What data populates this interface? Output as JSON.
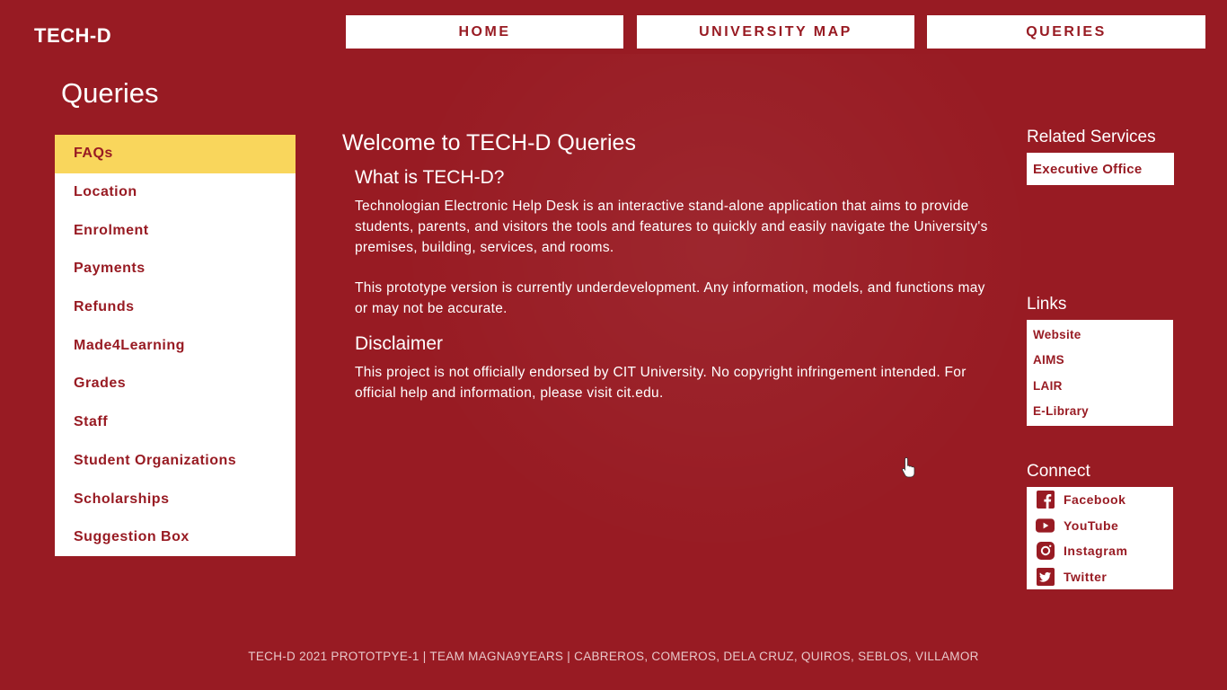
{
  "app": {
    "logo": "TECH-D"
  },
  "nav": {
    "home": "HOME",
    "map": "UNIVERSITY MAP",
    "queries": "QUERIES"
  },
  "page": {
    "title": "Queries"
  },
  "sidebar": {
    "items": [
      {
        "label": "FAQs",
        "active": true
      },
      {
        "label": "Location"
      },
      {
        "label": "Enrolment"
      },
      {
        "label": "Payments"
      },
      {
        "label": "Refunds"
      },
      {
        "label": "Made4Learning"
      },
      {
        "label": "Grades"
      },
      {
        "label": "Staff"
      },
      {
        "label": "Student Organizations"
      },
      {
        "label": "Scholarships"
      },
      {
        "label": "Suggestion Box"
      }
    ]
  },
  "main": {
    "title": "Welcome to TECH-D Queries",
    "what": {
      "heading": "What is TECH-D?",
      "p1": "Technologian Electronic Help Desk  is an interactive stand-alone application that aims to provide students, parents, and visitors the tools and features to quickly and easily navigate the University's premises, building, services, and rooms.",
      "p2": "This prototype version is currently underdevelopment. Any information, models, and functions may or may not be accurate."
    },
    "disclaimer": {
      "heading": "Disclaimer",
      "p": "This project is not officially endorsed by CIT University. No copyright infringement intended. For official help and information, please visit cit.edu."
    }
  },
  "related": {
    "heading": "Related Services",
    "items": [
      "Executive Office"
    ]
  },
  "links": {
    "heading": "Links",
    "items": [
      "Website",
      "AIMS",
      "LAIR",
      "E-Library"
    ]
  },
  "connect": {
    "heading": "Connect",
    "items": [
      {
        "label": "Facebook",
        "icon": "facebook-icon"
      },
      {
        "label": "YouTube",
        "icon": "youtube-icon"
      },
      {
        "label": "Instagram",
        "icon": "instagram-icon"
      },
      {
        "label": "Twitter",
        "icon": "twitter-icon"
      }
    ]
  },
  "footer": {
    "text": "TECH-D 2021 PROTOTPYE-1 | TEAM MAGNA9YEARS | CABREROS, COMEROS, DELA CRUZ, QUIROS, SEBLOS, VILLAMOR"
  },
  "colors": {
    "brand": "#981b23",
    "active": "#f9d65c",
    "panel": "#ffffff"
  }
}
